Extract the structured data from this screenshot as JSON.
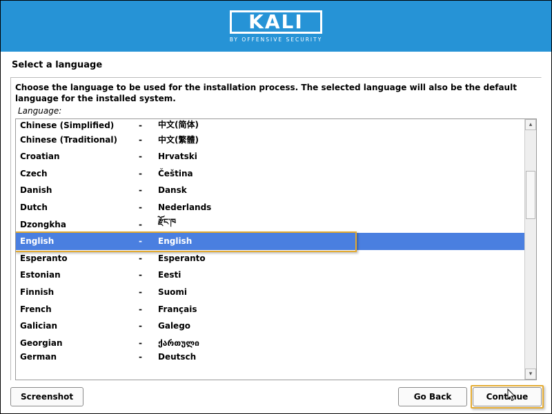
{
  "header": {
    "logo_text": "KALI",
    "logo_sub": "BY OFFENSIVE SECURITY"
  },
  "page": {
    "title": "Select a language",
    "instruction": "Choose the language to be used for the installation process. The selected language will also be the default language for the installed system.",
    "field_label": "Language:"
  },
  "languages": [
    {
      "name": "Chinese (Simplified)",
      "sep": "-",
      "native": "中文(简体)",
      "cutoff": "top"
    },
    {
      "name": "Chinese (Traditional)",
      "sep": "-",
      "native": "中文(繁體)"
    },
    {
      "name": "Croatian",
      "sep": "-",
      "native": "Hrvatski"
    },
    {
      "name": "Czech",
      "sep": "-",
      "native": "Čeština"
    },
    {
      "name": "Danish",
      "sep": "-",
      "native": "Dansk"
    },
    {
      "name": "Dutch",
      "sep": "-",
      "native": "Nederlands"
    },
    {
      "name": "Dzongkha",
      "sep": "-",
      "native": "རྫོང་ཁ"
    },
    {
      "name": "English",
      "sep": "-",
      "native": "English",
      "selected": true,
      "highlight": true
    },
    {
      "name": "Esperanto",
      "sep": "-",
      "native": "Esperanto"
    },
    {
      "name": "Estonian",
      "sep": "-",
      "native": "Eesti"
    },
    {
      "name": "Finnish",
      "sep": "-",
      "native": "Suomi"
    },
    {
      "name": "French",
      "sep": "-",
      "native": "Français"
    },
    {
      "name": "Galician",
      "sep": "-",
      "native": "Galego"
    },
    {
      "name": "Georgian",
      "sep": "-",
      "native": "ქართული"
    },
    {
      "name": "German",
      "sep": "-",
      "native": "Deutsch",
      "cutoff": "bot"
    }
  ],
  "buttons": {
    "screenshot": "Screenshot",
    "go_back": "Go Back",
    "continue": "Continue"
  }
}
